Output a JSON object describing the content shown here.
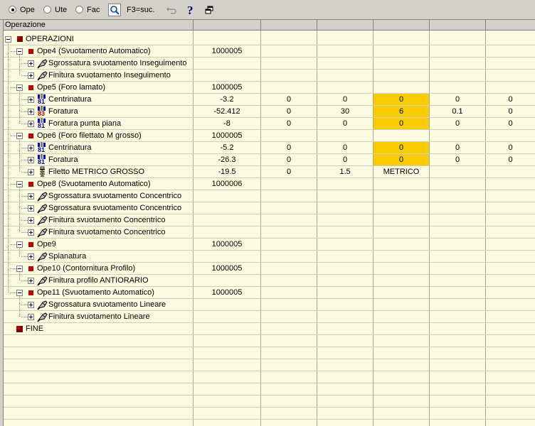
{
  "toolbar": {
    "radios": [
      {
        "label": "Ope",
        "checked": true
      },
      {
        "label": "Ute",
        "checked": false
      },
      {
        "label": "Fac",
        "checked": false
      }
    ],
    "hint": "F3=suc.",
    "icons": [
      "search-icon",
      "undo-icon",
      "help-icon",
      "restore-window-icon"
    ]
  },
  "grid": {
    "header": {
      "col0": "Operazione",
      "col1": "",
      "col2": "",
      "col3": "",
      "col4": "",
      "col5": "",
      "col6": ""
    },
    "highlight_color": "#f7cc00",
    "rows": [
      {
        "level": 0,
        "expander": "minus",
        "icon": "operation-root-icon",
        "name": "OPERAZIONI",
        "cells": [
          "",
          "",
          "",
          "",
          "",
          ""
        ]
      },
      {
        "level": 1,
        "expander": "minus",
        "icon": "operation-icon",
        "name": "Ope4 (Svuotamento Automatico)",
        "cells": [
          "1000005",
          "",
          "",
          "",
          "",
          ""
        ]
      },
      {
        "level": 2,
        "expander": "plus",
        "icon": "milling-tool-icon",
        "name": "Sgrossatura svuotamento Inseguimento",
        "cells": [
          "",
          "",
          "",
          "",
          "",
          ""
        ]
      },
      {
        "level": 2,
        "expander": "plus",
        "icon": "milling-tool-icon",
        "name": "Finitura svuotamento Inseguimento",
        "cells": [
          "",
          "",
          "",
          "",
          "",
          ""
        ]
      },
      {
        "level": 1,
        "expander": "minus",
        "icon": "operation-icon",
        "name": "Ope5 (Foro lamato)",
        "cells": [
          "1000005",
          "",
          "",
          "",
          "",
          ""
        ]
      },
      {
        "level": 2,
        "expander": "plus",
        "icon": "drill-cycle-81-icon",
        "badge": "81",
        "name": "Centrinatura",
        "cells": [
          "-3.2",
          "0",
          "0",
          "0",
          "0",
          "0"
        ],
        "hl": [
          3
        ]
      },
      {
        "level": 2,
        "expander": "plus",
        "icon": "drill-cycle-83-icon",
        "badge": "83",
        "name": "Foratura",
        "cells": [
          "-52.412",
          "0",
          "30",
          "6",
          "0.1",
          "0"
        ],
        "hl": [
          3
        ]
      },
      {
        "level": 2,
        "expander": "plus",
        "icon": "drill-cycle-81-icon",
        "badge": "81",
        "name": "Foratura punta piana",
        "cells": [
          "-8",
          "0",
          "0",
          "0",
          "0",
          "0"
        ],
        "hl": [
          3
        ]
      },
      {
        "level": 1,
        "expander": "minus",
        "icon": "operation-icon",
        "name": "Ope6 (Foro filettato M grosso)",
        "cells": [
          "1000005",
          "",
          "",
          "",
          "",
          ""
        ]
      },
      {
        "level": 2,
        "expander": "plus",
        "icon": "drill-cycle-81-icon",
        "badge": "81",
        "name": "Centrinatura",
        "cells": [
          "-5.2",
          "0",
          "0",
          "0",
          "0",
          "0"
        ],
        "hl": [
          3
        ]
      },
      {
        "level": 2,
        "expander": "plus",
        "icon": "drill-cycle-81-icon",
        "badge": "81",
        "name": "Foratura",
        "cells": [
          "-26.3",
          "0",
          "0",
          "0",
          "0",
          "0"
        ],
        "hl": [
          3
        ]
      },
      {
        "level": 2,
        "expander": "plus",
        "icon": "thread-tap-icon",
        "name": "Filetto METRICO GROSSO",
        "cells": [
          "-19.5",
          "0",
          "1.5",
          "METRICO",
          "",
          ""
        ]
      },
      {
        "level": 1,
        "expander": "minus",
        "icon": "operation-icon",
        "name": "Ope8 (Svuotamento Automatico)",
        "cells": [
          "1000006",
          "",
          "",
          "",
          "",
          ""
        ]
      },
      {
        "level": 2,
        "expander": "plus",
        "icon": "milling-tool-icon",
        "name": "Sgrossatura svuotamento Concentrico",
        "cells": [
          "",
          "",
          "",
          "",
          "",
          ""
        ]
      },
      {
        "level": 2,
        "expander": "plus",
        "icon": "milling-tool-icon",
        "name": "Sgrossatura svuotamento Concentrico",
        "cells": [
          "",
          "",
          "",
          "",
          "",
          ""
        ]
      },
      {
        "level": 2,
        "expander": "plus",
        "icon": "milling-tool-icon",
        "name": "Finitura svuotamento Concentrico",
        "cells": [
          "",
          "",
          "",
          "",
          "",
          ""
        ]
      },
      {
        "level": 2,
        "expander": "plus",
        "icon": "milling-tool-icon",
        "name": "Finitura svuotamento Concentrico",
        "cells": [
          "",
          "",
          "",
          "",
          "",
          ""
        ]
      },
      {
        "level": 1,
        "expander": "minus",
        "icon": "operation-icon",
        "name": "Ope9",
        "cells": [
          "1000005",
          "",
          "",
          "",
          "",
          ""
        ]
      },
      {
        "level": 2,
        "expander": "plus",
        "icon": "milling-tool-icon",
        "name": "Spianatura",
        "cells": [
          "",
          "",
          "",
          "",
          "",
          ""
        ]
      },
      {
        "level": 1,
        "expander": "minus",
        "icon": "operation-icon",
        "name": "Ope10 (Contornitura Profilo)",
        "cells": [
          "1000005",
          "",
          "",
          "",
          "",
          ""
        ]
      },
      {
        "level": 2,
        "expander": "plus",
        "icon": "milling-tool-icon",
        "name": "Finitura profilo ANTIORARIO",
        "cells": [
          "",
          "",
          "",
          "",
          "",
          ""
        ]
      },
      {
        "level": 1,
        "expander": "minus",
        "icon": "operation-icon",
        "name": "Ope11 (Svuotamento Automatico)",
        "cells": [
          "1000005",
          "",
          "",
          "",
          "",
          ""
        ]
      },
      {
        "level": 2,
        "expander": "plus",
        "icon": "milling-tool-icon",
        "name": "Sgrossatura svuotamento Lineare",
        "cells": [
          "",
          "",
          "",
          "",
          "",
          ""
        ]
      },
      {
        "level": 2,
        "expander": "plus",
        "icon": "milling-tool-icon",
        "name": "Finitura svuotamento Lineare",
        "cells": [
          "",
          "",
          "",
          "",
          "",
          ""
        ]
      },
      {
        "level": 0,
        "expander": "none",
        "icon": "end-icon",
        "name": "FINE",
        "cells": [
          "",
          "",
          "",
          "",
          "",
          ""
        ]
      }
    ]
  }
}
